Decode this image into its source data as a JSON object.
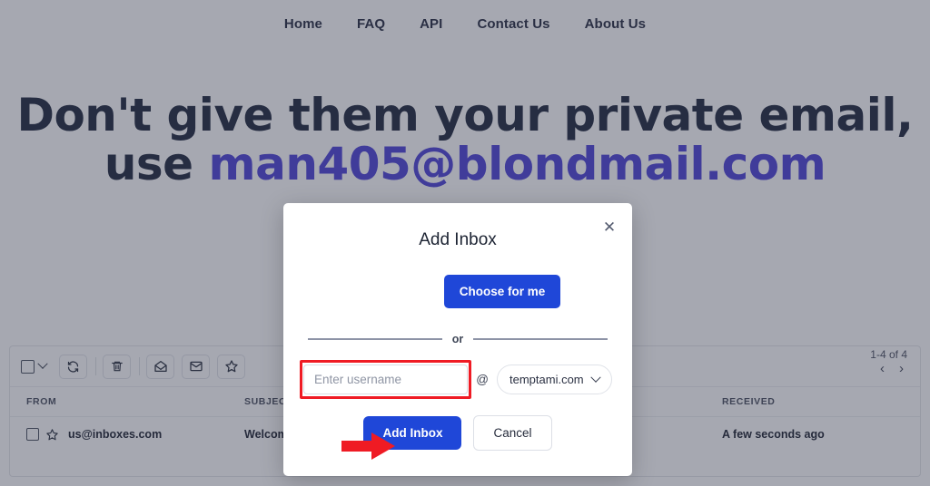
{
  "nav": {
    "items": [
      {
        "label": "Home"
      },
      {
        "label": "FAQ"
      },
      {
        "label": "API"
      },
      {
        "label": "Contact Us"
      },
      {
        "label": "About Us"
      }
    ]
  },
  "hero": {
    "line1": "Don't give them your private email,",
    "line2_prefix": "use ",
    "email": "man405@blondmail.com",
    "email_color": "#4338d4"
  },
  "mailbox": {
    "toolbar": {
      "select_all_icon": "checkbox-icon",
      "select_all_caret_icon": "chevron-down-icon",
      "refresh_icon": "refresh-icon",
      "delete_icon": "trash-icon",
      "mark_read_icon": "open-envelope-icon",
      "mark_unread_icon": "closed-envelope-icon",
      "star_icon": "star-icon"
    },
    "pager": {
      "count_label": "1-4 of 4",
      "prev_icon": "chevron-left-icon",
      "next_icon": "chevron-right-icon"
    },
    "columns": {
      "from": "FROM",
      "subject": "SUBJECT",
      "subject_sort_caret": "▾",
      "received": "RECEIVED"
    },
    "rows": [
      {
        "checkbox_icon": "checkbox-icon",
        "star_icon": "star-outline-icon",
        "from": "us@inboxes.com",
        "subject": "Welcome to Inboxes Service",
        "received": "A few seconds ago"
      }
    ]
  },
  "modal": {
    "title": "Add Inbox",
    "close_icon": "close-icon",
    "choose_for_me_label": "Choose for me",
    "or_label": "or",
    "username_placeholder": "Enter username",
    "username_value": "",
    "at_symbol": "@",
    "domain_selected": "temptami.com",
    "domain_caret_icon": "chevron-down-icon",
    "add_label": "Add Inbox",
    "cancel_label": "Cancel",
    "accent_color": "#1f47d8",
    "highlight_color": "#ef1b24"
  },
  "annotations": {
    "arrow_icon": "red-arrow-right-icon",
    "arrow_color": "#ef1b24",
    "highlight_target": "Enter username"
  }
}
